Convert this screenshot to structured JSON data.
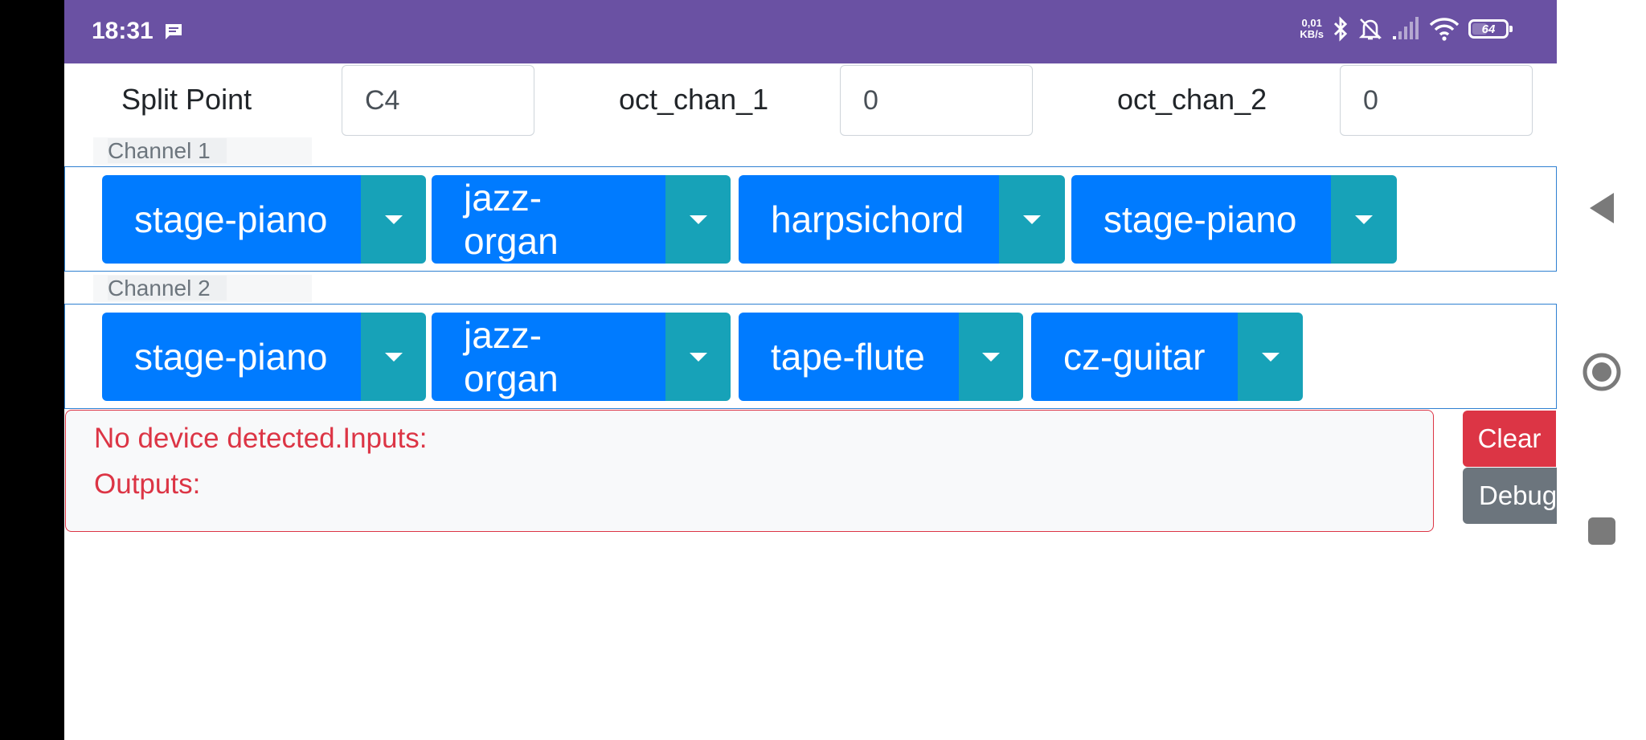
{
  "status_bar": {
    "time": "18:31",
    "net_speed_value": "0,01",
    "net_speed_unit": "KB/s",
    "battery": "64",
    "icons": [
      "message-icon",
      "bluetooth-icon",
      "mute-bell-icon",
      "signal-icon",
      "wifi-icon",
      "battery-icon"
    ]
  },
  "params": {
    "split_point_label": "Split Point",
    "split_point_value": "C4",
    "oct_chan_1_label": "oct_chan_1",
    "oct_chan_1_value": "0",
    "oct_chan_2_label": "oct_chan_2",
    "oct_chan_2_value": "0"
  },
  "channels": [
    {
      "label": "Channel 1",
      "instruments": [
        "stage-piano",
        "jazz-organ",
        "harpsichord",
        "stage-piano"
      ]
    },
    {
      "label": "Channel 2",
      "instruments": [
        "stage-piano",
        "jazz-organ",
        "tape-flute",
        "cz-guitar"
      ]
    }
  ],
  "log": {
    "line1": "No device detected.Inputs:",
    "line2": "Outputs:"
  },
  "buttons": {
    "clear": "Clear",
    "debug": "Debug"
  },
  "colors": {
    "status_bar": "#6a51a3",
    "primary": "#007bff",
    "toggle": "#17a2b8",
    "danger": "#dc3545",
    "secondary": "#6c757d"
  },
  "nav": [
    "back-icon",
    "home-icon",
    "recents-icon"
  ]
}
